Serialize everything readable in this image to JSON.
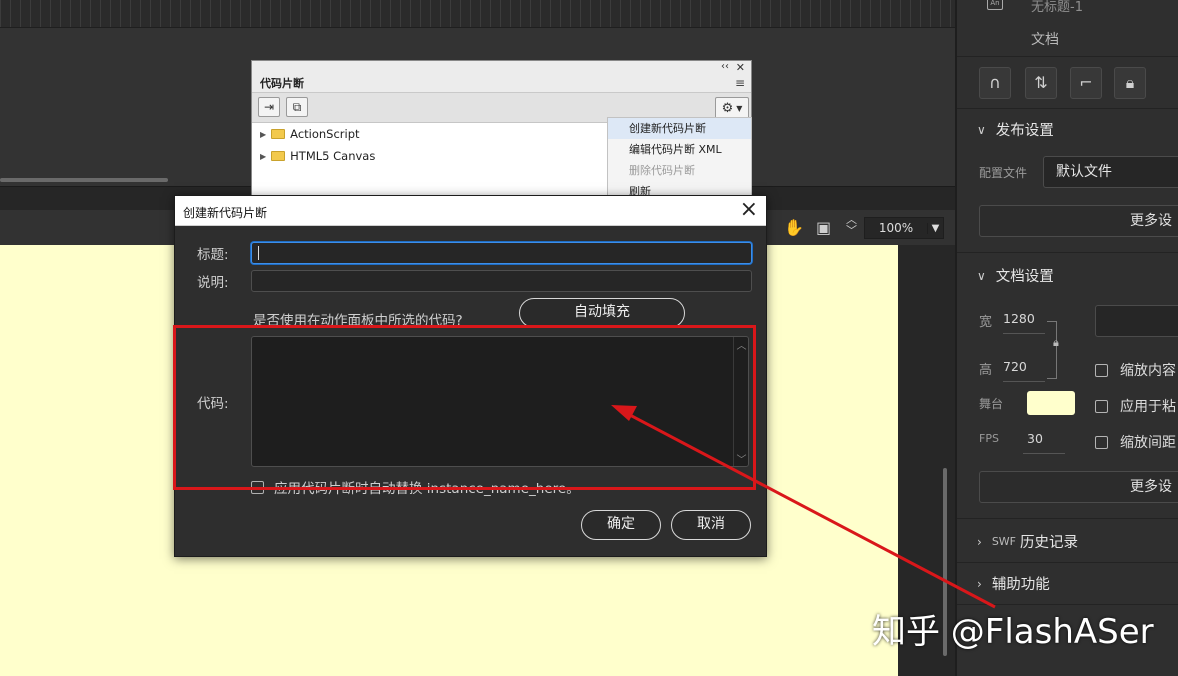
{
  "snippets_panel": {
    "title": "代码片断",
    "collapse_glyph": "‹‹",
    "close_glyph": "✕",
    "tree": [
      {
        "label": "ActionScript"
      },
      {
        "label": "HTML5 Canvas"
      }
    ],
    "context_menu": [
      {
        "label": "创建新代码片断",
        "state": "highlighted"
      },
      {
        "label": "编辑代码片断 XML",
        "state": "normal"
      },
      {
        "label": "删除代码片断",
        "state": "disabled"
      },
      {
        "label": "刷新",
        "state": "normal"
      }
    ]
  },
  "stage_toolbar": {
    "zoom": "100%"
  },
  "dialog": {
    "title": "创建新代码片断",
    "title_label": "标题:",
    "title_value": "",
    "desc_label": "说明:",
    "desc_value": "",
    "use_selected_text": "是否使用在动作面板中所选的代码?",
    "autofill_label": "自动填充",
    "code_label": "代码:",
    "code_value": "",
    "auto_replace_text": "应用代码片断时自动替换 instance_name_here。",
    "auto_replace_checked": false,
    "ok_label": "确定",
    "cancel_label": "取消"
  },
  "right_panel": {
    "doc_icon_text": "An",
    "doc_name": "无标题-1",
    "doc_type": "文档",
    "publish_settings": {
      "header": "发布设置",
      "profile_label": "配置文件",
      "profile_value": "默认文件",
      "more_label": "更多设"
    },
    "doc_settings": {
      "header": "文档设置",
      "width_label": "宽",
      "width_value": "1280",
      "height_label": "高",
      "height_value": "720",
      "stage_label": "舞台",
      "stage_color": "#FFFFCC",
      "fps_label": "FPS",
      "fps_value": "30",
      "checkbox_scale_content": "缩放内容",
      "checkbox_apply_paste": "应用于粘",
      "checkbox_scale_spacing": "缩放间距",
      "more_label": "更多设"
    },
    "swf_history": {
      "prefix": "SWF",
      "header": "历史记录"
    },
    "accessibility": {
      "header": "辅助功能"
    }
  },
  "watermark": "知乎 @FlashASer",
  "annotation_color": "#D9171A"
}
